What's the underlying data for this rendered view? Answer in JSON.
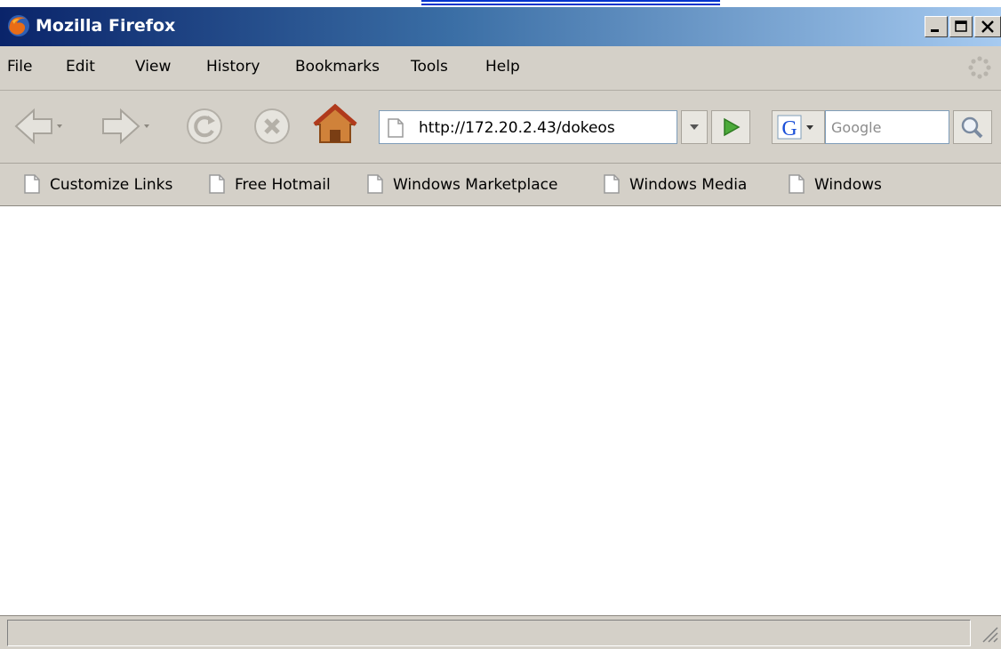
{
  "window": {
    "title": "Mozilla Firefox",
    "controls": [
      "minimize",
      "maximize",
      "close"
    ]
  },
  "menu": {
    "items": [
      "File",
      "Edit",
      "View",
      "History",
      "Bookmarks",
      "Tools",
      "Help"
    ]
  },
  "nav": {
    "url": "http://172.20.2.43/dokeos",
    "search_placeholder": "Google",
    "search_engine": "Google"
  },
  "bookmarks": {
    "items": [
      "Customize Links",
      "Free Hotmail",
      "Windows Marketplace",
      "Windows Media",
      "Windows"
    ]
  },
  "status": {
    "text": ""
  },
  "colors": {
    "titlebar_start": "#0a246a",
    "titlebar_end": "#a6caf0",
    "chrome": "#d4d0c8",
    "link": "#0033cc"
  },
  "icons": {
    "app": "firefox-logo-icon",
    "back": "back-arrow-icon",
    "forward": "forward-arrow-icon",
    "reload": "reload-icon",
    "stop": "stop-icon",
    "home": "home-icon",
    "page": "page-icon",
    "go": "go-arrow-icon",
    "search": "magnifier-icon"
  }
}
